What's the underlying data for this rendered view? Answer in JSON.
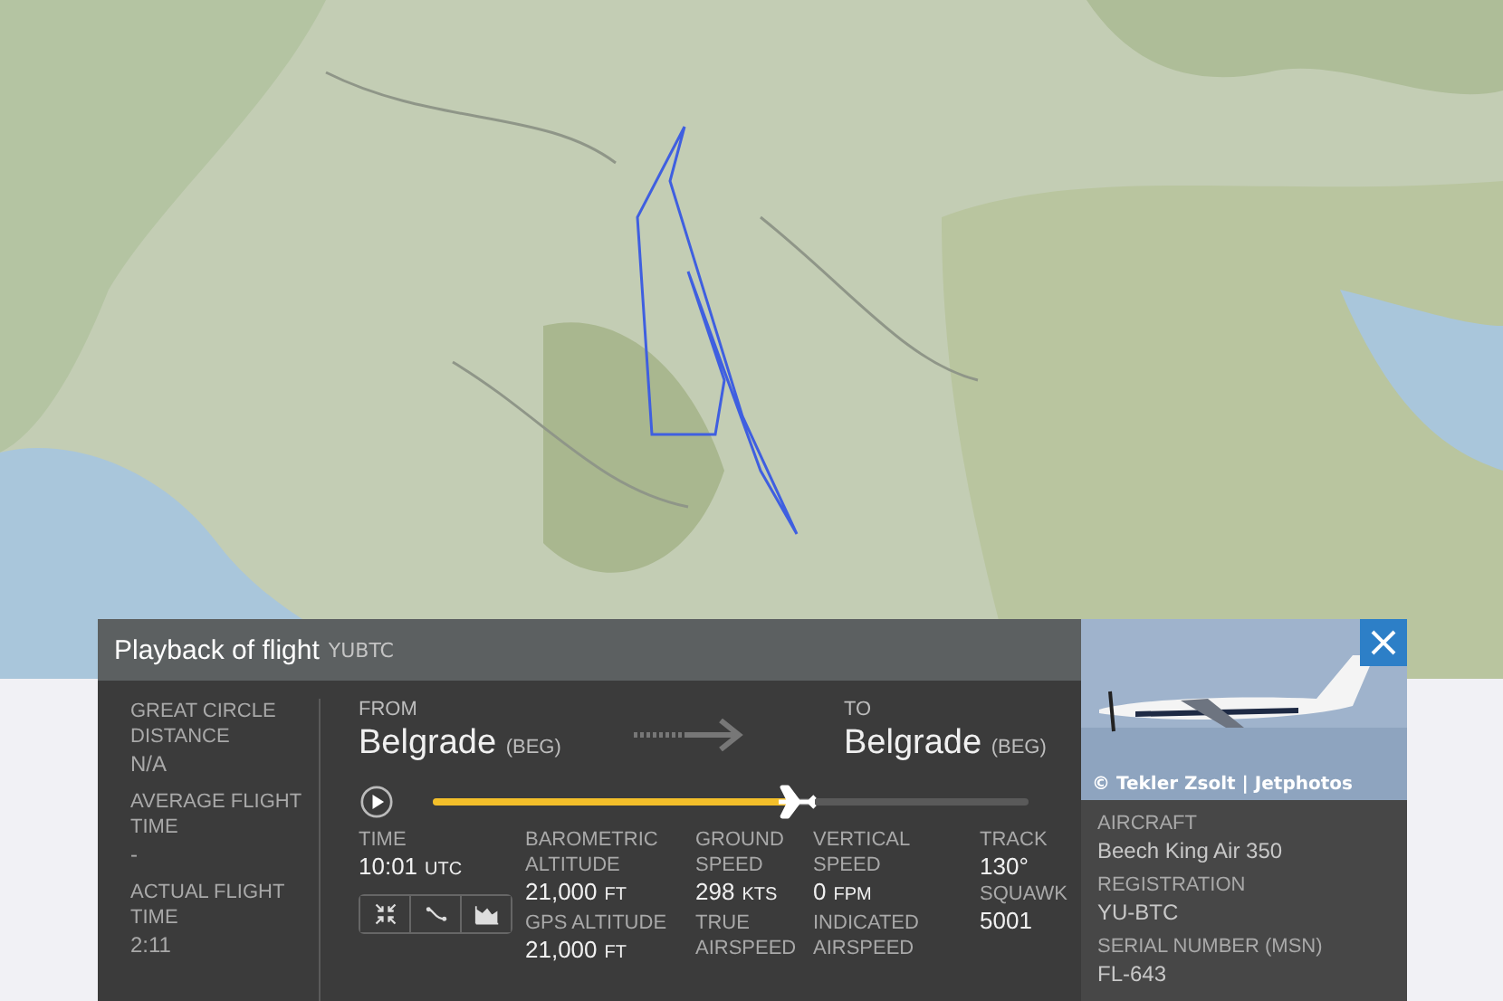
{
  "header": {
    "title": "Playback of flight",
    "callsign": "YUBTC"
  },
  "summary": [
    {
      "label": "GREAT CIRCLE DISTANCE",
      "value": "N/A"
    },
    {
      "label": "AVERAGE FLIGHT TIME",
      "value": "-"
    },
    {
      "label": "ACTUAL FLIGHT TIME",
      "value": "2:11"
    }
  ],
  "route": {
    "from_label": "FROM",
    "from_city": "Belgrade",
    "from_code": "(BEG)",
    "to_label": "TO",
    "to_city": "Belgrade",
    "to_code": "(BEG)"
  },
  "playback": {
    "playing": false,
    "level": 0.6
  },
  "stats": [
    {
      "kind": "time",
      "items": [
        {
          "label": "TIME",
          "value": "10:01",
          "unit": "UTC"
        }
      ]
    },
    {
      "kind": "pair",
      "items": [
        {
          "label": "BAROMETRIC ALTITUDE",
          "value": "21,000",
          "unit": "FT"
        },
        {
          "label": "GPS ALTITUDE",
          "value": "21,000",
          "unit": "FT"
        }
      ]
    },
    {
      "kind": "pair",
      "items": [
        {
          "label": "GROUND SPEED",
          "value": "298",
          "unit": "KTS"
        },
        {
          "label": "TRUE AIRSPEED"
        }
      ]
    },
    {
      "kind": "pair",
      "items": [
        {
          "label": "VERTICAL SPEED",
          "value": "0",
          "unit": "FPM"
        },
        {
          "label": "INDICATED AIRSPEED"
        }
      ]
    },
    {
      "kind": "pair",
      "items": [
        {
          "label": "TRACK",
          "value": "130°"
        },
        {
          "label": "SQUAWK",
          "value": "5001"
        }
      ]
    }
  ],
  "view_buttons": [
    {
      "kind": "collapse",
      "selected": false
    },
    {
      "kind": "route",
      "selected": false
    },
    {
      "kind": "chart",
      "selected": false
    }
  ],
  "photo": {
    "kind": "picture",
    "credit": "© Tekler Zsolt | Jetphotos"
  },
  "aircraft": [
    {
      "label": "AIRCRAFT",
      "value": "Beech King Air 350"
    },
    {
      "label": "REGISTRATION",
      "value": "YU-BTC"
    },
    {
      "label": "SERIAL NUMBER (MSN)",
      "value": "FL-643"
    }
  ]
}
